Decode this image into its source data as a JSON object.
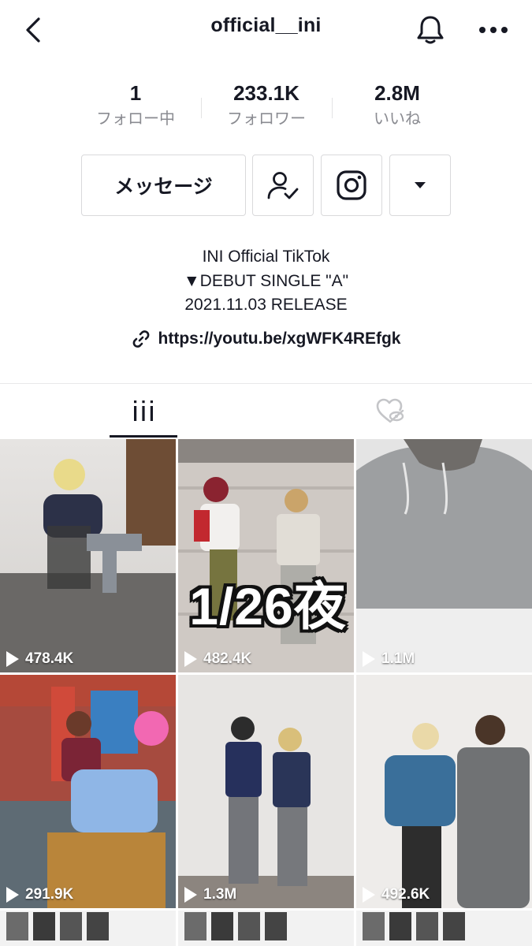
{
  "header": {
    "username": "official__ini"
  },
  "stats": [
    {
      "value": "1",
      "label": "フォロー中"
    },
    {
      "value": "233.1K",
      "label": "フォロワー"
    },
    {
      "value": "2.8M",
      "label": "いいね"
    }
  ],
  "actions": {
    "message_label": "メッセージ"
  },
  "bio": {
    "line1": "INI Official TikTok",
    "line2": "▼DEBUT SINGLE \"A\"",
    "line3": "2021.11.03 RELEASE",
    "link": "https://youtu.be/xgWFK4REfgk"
  },
  "tabs": {
    "active": "videos"
  },
  "overlay_caption": "1/26夜",
  "videos": [
    {
      "views": "478.4K"
    },
    {
      "views": "482.4K"
    },
    {
      "views": "1.1M"
    },
    {
      "views": "291.9K"
    },
    {
      "views": "1.3M"
    },
    {
      "views": "492.6K"
    }
  ]
}
